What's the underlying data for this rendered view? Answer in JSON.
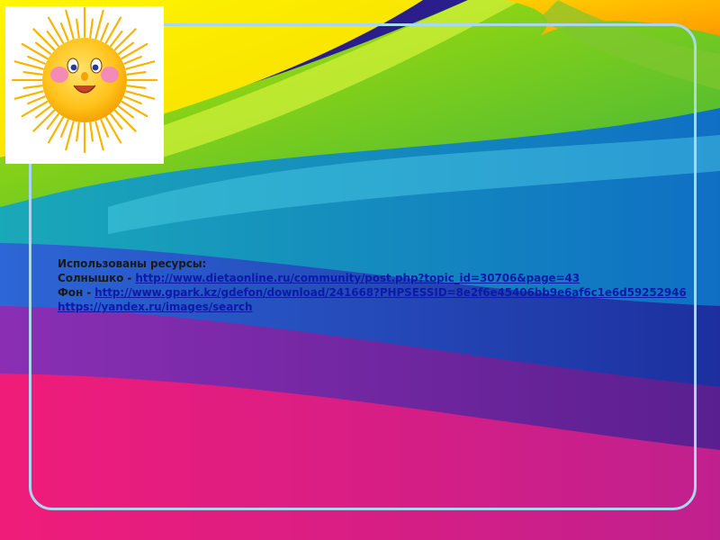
{
  "slide": {
    "credits": {
      "heading": "Использованы ресурсы:",
      "sun_prefix": "Солнышко - ",
      "sun_link": "http://www.dietaonline.ru/community/post.php?topic_id=30706&page=43",
      "bg_prefix": "Фон - ",
      "bg_link": "http://www.gpark.kz/gdefon/download/241668?PHPSESSID=8e2f6e45406bb9e6af6c1e6d59252946",
      "yandex_link": "https://yandex.ru/images/search"
    }
  },
  "colors": {
    "frame": "#a9d8ee",
    "link": "#0b1aa8",
    "text": "#1a1a1a"
  },
  "icons": {
    "sun": "sun-face-icon"
  }
}
